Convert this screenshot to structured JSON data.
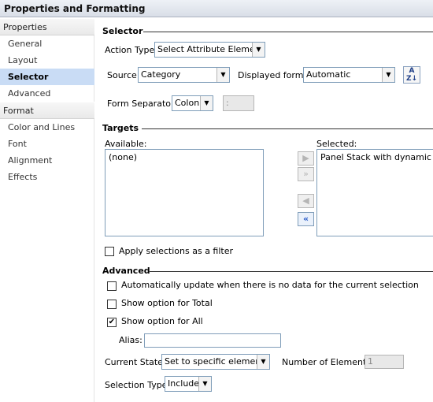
{
  "window": {
    "title": "Properties and Formatting"
  },
  "sidebar": {
    "sections": [
      {
        "label": "Properties",
        "items": [
          "General",
          "Layout",
          "Selector",
          "Advanced"
        ]
      },
      {
        "label": "Format",
        "items": [
          "Color and Lines",
          "Font",
          "Alignment",
          "Effects"
        ]
      }
    ],
    "active_item": "Selector"
  },
  "selector": {
    "heading": "Selector",
    "action_type_label": "Action Type:",
    "action_type_value": "Select Attribute Element",
    "source_label": "Source:",
    "source_value": "Category",
    "displayed_forms_label": "Displayed forms:",
    "displayed_forms_value": "Automatic",
    "form_separator_label": "Form Separator:",
    "form_separator_value": "Colon",
    "form_separator_custom": ":"
  },
  "targets": {
    "heading": "Targets",
    "available_label": "Available:",
    "available_items": [
      "(none)"
    ],
    "selected_label": "Selected:",
    "selected_items": [
      "Panel Stack with dynamic text"
    ],
    "apply_filter_label": "Apply selections as a filter",
    "apply_filter_checked": false
  },
  "advanced": {
    "heading": "Advanced",
    "auto_update_label": "Automatically update when there is no data for the current selection",
    "auto_update_checked": false,
    "show_total_label": "Show option for Total",
    "show_total_checked": false,
    "show_all_label": "Show option for All",
    "show_all_checked": true,
    "alias_label": "Alias:",
    "alias_value": "",
    "current_state_label": "Current State:",
    "current_state_value": "Set to specific elements",
    "num_elements_label": "Number of Elements:",
    "num_elements_value": "1",
    "selection_type_label": "Selection Type:",
    "selection_type_value": "Include"
  },
  "check_glyph": "✔"
}
